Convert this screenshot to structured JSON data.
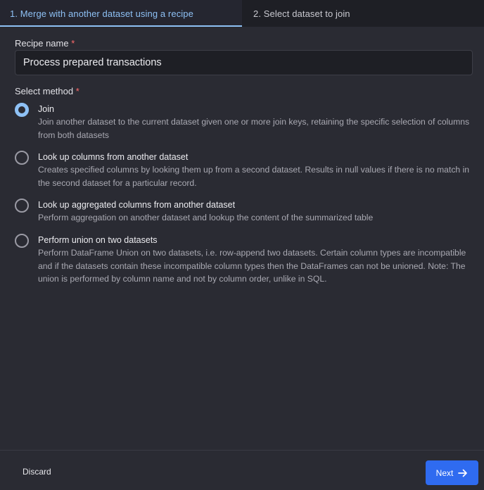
{
  "tabs": [
    {
      "label": "1. Merge with another dataset using a recipe",
      "active": true
    },
    {
      "label": "2. Select dataset to join",
      "active": false
    }
  ],
  "form": {
    "recipe_name_label": "Recipe name",
    "required_marker": "*",
    "recipe_name_value": "Process prepared transactions",
    "select_method_label": "Select method"
  },
  "methods": [
    {
      "title": "Join",
      "description": "Join another dataset to the current dataset given one or more join keys, retaining the specific selection of columns from both datasets",
      "selected": true
    },
    {
      "title": "Look up columns from another dataset",
      "description": "Creates specified columns by looking them up from a second dataset. Results in null values if there is no match in the second dataset for a particular record.",
      "selected": false
    },
    {
      "title": "Look up aggregated columns from another dataset",
      "description": "Perform aggregation on another dataset and lookup the content of the summarized table",
      "selected": false
    },
    {
      "title": "Perform union on two datasets",
      "description": "Perform DataFrame Union on two datasets, i.e. row-append two datasets. Certain column types are incompatible and if the datasets contain these incompatible column types then the DataFrames can not be unioned. Note: The union is performed by column name and not by column order, unlike in SQL.",
      "selected": false
    }
  ],
  "footer": {
    "discard_label": "Discard",
    "next_label": "Next",
    "next_icon": "arrow-right-icon"
  },
  "colors": {
    "accent": "#8ec1f5",
    "primary_button": "#2f6bf0",
    "required": "#ff6b6b",
    "background": "#2a2b33"
  }
}
